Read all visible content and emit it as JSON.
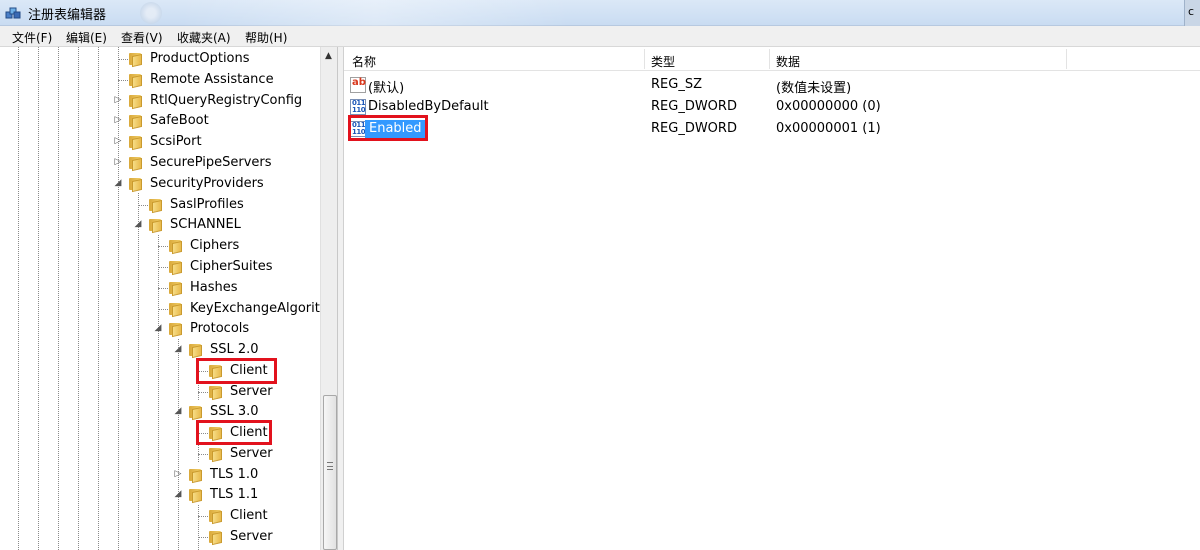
{
  "window": {
    "title": "注册表编辑器"
  },
  "menu": [
    "文件(F)",
    "编辑(E)",
    "查看(V)",
    "收藏夹(A)",
    "帮助(H)"
  ],
  "tree": [
    {
      "label": "ProductOptions",
      "expander": ""
    },
    {
      "label": "Remote Assistance",
      "expander": ""
    },
    {
      "label": "RtlQueryRegistryConfig",
      "expander": "▷"
    },
    {
      "label": "SafeBoot",
      "expander": "▷"
    },
    {
      "label": "ScsiPort",
      "expander": "▷"
    },
    {
      "label": "SecurePipeServers",
      "expander": "▷"
    },
    {
      "label": "SecurityProviders",
      "expander": "◢"
    },
    {
      "label": "SaslProfiles",
      "expander": ""
    },
    {
      "label": "SCHANNEL",
      "expander": "◢"
    },
    {
      "label": "Ciphers",
      "expander": ""
    },
    {
      "label": "CipherSuites",
      "expander": ""
    },
    {
      "label": "Hashes",
      "expander": ""
    },
    {
      "label": "KeyExchangeAlgorithms",
      "expander": ""
    },
    {
      "label": "Protocols",
      "expander": "◢"
    },
    {
      "label": "SSL 2.0",
      "expander": "◢"
    },
    {
      "label": "Client",
      "expander": ""
    },
    {
      "label": "Server",
      "expander": ""
    },
    {
      "label": "SSL 3.0",
      "expander": "◢"
    },
    {
      "label": "Client",
      "expander": ""
    },
    {
      "label": "Server",
      "expander": ""
    },
    {
      "label": "TLS 1.0",
      "expander": "▷"
    },
    {
      "label": "TLS 1.1",
      "expander": "◢"
    },
    {
      "label": "Client",
      "expander": ""
    },
    {
      "label": "Server",
      "expander": ""
    }
  ],
  "list": {
    "columns": [
      "名称",
      "类型",
      "数据"
    ],
    "rows": [
      {
        "name": "(默认)",
        "type": "REG_SZ",
        "data": "(数值未设置)",
        "icon": "string-value-icon"
      },
      {
        "name": "DisabledByDefault",
        "type": "REG_DWORD",
        "data": "0x00000000 (0)",
        "icon": "binary-value-icon"
      },
      {
        "name": "Enabled",
        "type": "REG_DWORD",
        "data": "0x00000001 (1)",
        "icon": "binary-value-icon",
        "selected": true
      }
    ]
  },
  "colors": {
    "highlight": "#e2121d",
    "selection": "#3399ff"
  }
}
